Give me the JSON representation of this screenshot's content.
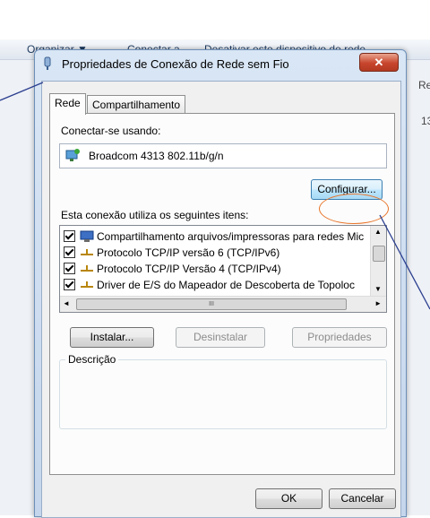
{
  "background_window": {
    "toolbar_items": [
      "Organizar ▼",
      "Conectar a",
      "Desativar este dispositivo de rede"
    ],
    "right_texts": [
      "Re",
      "13"
    ]
  },
  "dialog": {
    "title": "Propriedades de Conexão de Rede sem Fio",
    "close_glyph": "✕",
    "tabs": [
      "Rede",
      "Compartilhamento"
    ],
    "connect_using_label": "Conectar-se usando:",
    "adapter_name": "Broadcom 4313 802.11b/g/n",
    "configure_button": "Configurar...",
    "items_label": "Esta conexão utiliza os seguintes itens:",
    "items": [
      {
        "label": "Compartilhamento arquivos/impressoras para redes Mic",
        "checked": true,
        "icon": "network-share-icon"
      },
      {
        "label": "Protocolo TCP/IP versão 6 (TCP/IPv6)",
        "checked": true,
        "icon": "protocol-icon"
      },
      {
        "label": "Protocolo TCP/IP Versão 4 (TCP/IPv4)",
        "checked": true,
        "icon": "protocol-icon"
      },
      {
        "label": "Driver de E/S do Mapeador de Descoberta de Topoloc",
        "checked": true,
        "icon": "protocol-icon"
      }
    ],
    "scroll_glyphs": {
      "up": "▲",
      "down": "▼",
      "left": "◄",
      "right": "►",
      "grip": "III"
    },
    "install_button": "Instalar...",
    "uninstall_button": "Desinstalar",
    "properties_button": "Propriedades",
    "description_label": "Descrição",
    "ok_button": "OK",
    "cancel_button": "Cancelar"
  },
  "colors": {
    "annotation_line": "#2b3f8f",
    "highlight_circle": "#e8752a"
  }
}
